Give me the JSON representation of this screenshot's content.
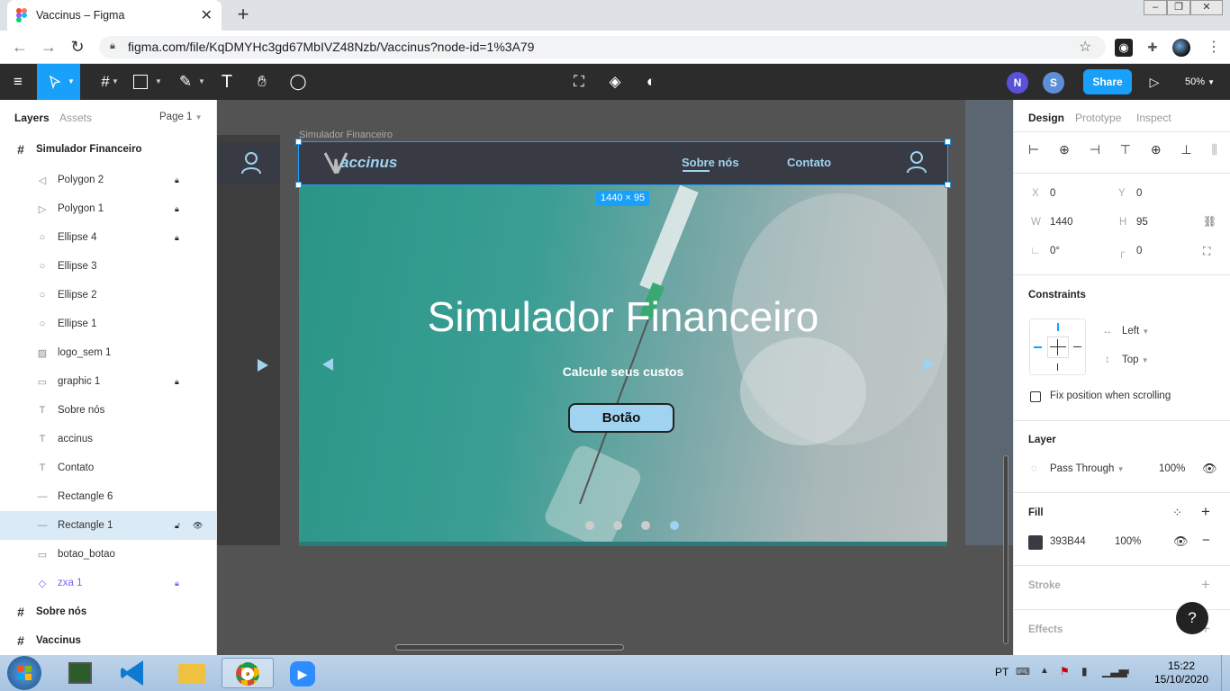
{
  "browser": {
    "tab_title": "Vaccinus – Figma",
    "tab_close": "✕",
    "new_tab": "+",
    "url": "figma.com/file/KqDMYHc3gd67MbIVZ48Nzb/Vaccinus?node-id=1%3A79"
  },
  "toolbar": {
    "avatars": [
      {
        "letter": "N",
        "color": "#5b51d8"
      },
      {
        "letter": "S",
        "color": "#5e8fd6"
      }
    ],
    "share_label": "Share",
    "zoom_label": "50%"
  },
  "layers_panel": {
    "tabs": {
      "layers": "Layers",
      "assets": "Assets"
    },
    "page_label": "Page 1",
    "items": [
      {
        "label": "Simulador Financeiro",
        "kind": "frame"
      },
      {
        "label": "Polygon 2",
        "kind": "polygon-left",
        "locked": true
      },
      {
        "label": "Polygon 1",
        "kind": "polygon-right",
        "locked": true
      },
      {
        "label": "Ellipse 4",
        "kind": "ellipse",
        "locked": true
      },
      {
        "label": "Ellipse 3",
        "kind": "ellipse"
      },
      {
        "label": "Ellipse 2",
        "kind": "ellipse"
      },
      {
        "label": "Ellipse 1",
        "kind": "ellipse"
      },
      {
        "label": "logo_sem 1",
        "kind": "image"
      },
      {
        "label": "graphic 1",
        "kind": "rect",
        "locked": true
      },
      {
        "label": "Sobre nós",
        "kind": "text"
      },
      {
        "label": "accinus",
        "kind": "text"
      },
      {
        "label": "Contato",
        "kind": "text"
      },
      {
        "label": "Rectangle 6",
        "kind": "line"
      },
      {
        "label": "Rectangle 1",
        "kind": "line",
        "selected": true
      },
      {
        "label": "botao_botao",
        "kind": "component"
      },
      {
        "label": "zxa 1",
        "kind": "instance",
        "locked": true
      },
      {
        "label": "Sobre nós",
        "kind": "frame"
      },
      {
        "label": "Vaccinus",
        "kind": "frame"
      }
    ]
  },
  "canvas": {
    "frame_label": "Simulador Financeiro",
    "size_badge": "1440 × 95",
    "site": {
      "logo": "Vaccinus",
      "nav": [
        "Sobre nós",
        "Contato"
      ],
      "hero_title": "Simulador Financeiro",
      "hero_subtitle": "Calcule seus custos",
      "button_label": "Botão",
      "active_dot": 3
    }
  },
  "design_panel": {
    "tabs": {
      "design": "Design",
      "prototype": "Prototype",
      "inspect": "Inspect"
    },
    "x_label": "X",
    "x": "0",
    "y_label": "Y",
    "y": "0",
    "w_label": "W",
    "w": "1440",
    "h_label": "H",
    "h": "95",
    "rotation": "0°",
    "radius": "0",
    "constraints_title": "Constraints",
    "constraint_h": "Left",
    "constraint_v": "Top",
    "fix_position": "Fix position when scrolling",
    "layer_title": "Layer",
    "blend": "Pass Through",
    "opacity": "100%",
    "fill_title": "Fill",
    "fill_hex": "393B44",
    "fill_opacity": "100%",
    "fill_color": "#393b44",
    "stroke_title": "Stroke",
    "effects_title": "Effects",
    "help": "?"
  },
  "taskbar": {
    "lang": "PT",
    "time": "15:22",
    "date": "15/10/2020"
  }
}
